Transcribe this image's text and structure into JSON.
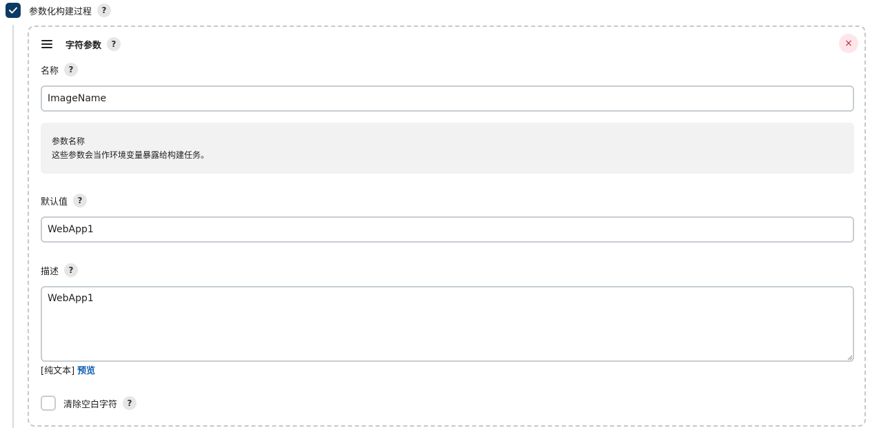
{
  "parameterized": {
    "checked": true,
    "label": "参数化构建过程",
    "help": "?"
  },
  "param_card": {
    "title": "字符参数",
    "help": "?",
    "close_symbol": "×",
    "name": {
      "label": "名称",
      "help": "?",
      "value": "ImageName"
    },
    "info": {
      "line1": "参数名称",
      "line2": "这些参数会当作环境变量暴露给构建任务。"
    },
    "default": {
      "label": "默认值",
      "help": "?",
      "value": "WebApp1"
    },
    "description": {
      "label": "描述",
      "help": "?",
      "value": "WebApp1",
      "format_label": "[纯文本]",
      "preview_link": "预览"
    },
    "trim": {
      "checked": false,
      "label": "清除空白字符",
      "help": "?"
    }
  },
  "colors": {
    "accent": "#0b3a63",
    "link": "#1460b5",
    "close_bg": "#fde6ea",
    "close_fg": "#d0263e"
  }
}
